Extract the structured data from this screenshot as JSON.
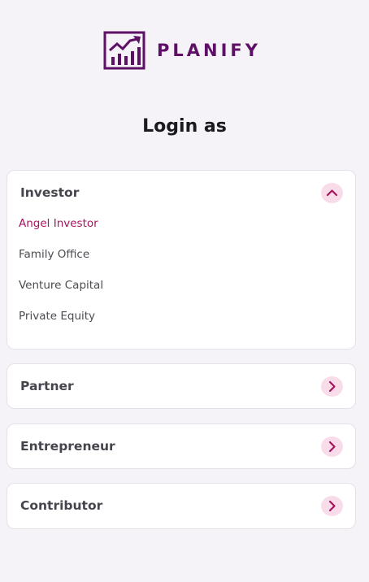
{
  "brand": {
    "name": "PLANIFY",
    "logo_icon": "chart-growth-icon",
    "color": "#5e0f66"
  },
  "page_title": "Login as",
  "accent_color": "#a8155f",
  "accordion": {
    "investor": {
      "title": "Investor",
      "expanded": true,
      "icon": "chevron-up-icon",
      "options": [
        {
          "label": "Angel Investor",
          "selected": true
        },
        {
          "label": "Family Office",
          "selected": false
        },
        {
          "label": "Venture Capital",
          "selected": false
        },
        {
          "label": "Private Equity",
          "selected": false
        }
      ]
    },
    "partner": {
      "title": "Partner",
      "expanded": false,
      "icon": "chevron-right-icon"
    },
    "entrepreneur": {
      "title": "Entrepreneur",
      "expanded": false,
      "icon": "chevron-right-icon"
    },
    "contributor": {
      "title": "Contributor",
      "expanded": false,
      "icon": "chevron-right-icon"
    }
  }
}
